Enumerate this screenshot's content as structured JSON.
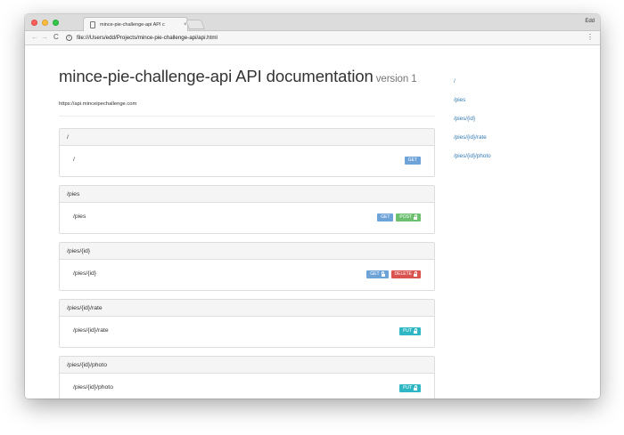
{
  "browser": {
    "tab_title": "mince-pie-challenge-api API c",
    "tab_close": "×",
    "profile_name": "Edd",
    "url": "file:///Users/edd/Projects/mince-pie-challenge-api/api.html",
    "icons": [
      "close-light",
      "minimize-light",
      "zoom-light",
      "document-icon",
      "back-arrow-icon",
      "forward-arrow-icon",
      "reload-icon",
      "info-icon",
      "menu-dots-icon",
      "lock-icon"
    ]
  },
  "page": {
    "title": "mince-pie-challenge-api API documentation",
    "version": "version 1",
    "base_url": "https://api.minceipechallenge.com"
  },
  "colors": {
    "get": "#5bc0de",
    "get_blue": "#6ea3d8",
    "post": "#5cb85c",
    "delete": "#d9534f",
    "put": "#30b7c4",
    "link": "#337ab7"
  },
  "resources": [
    {
      "header": "/",
      "path": "/",
      "methods": [
        {
          "label": "GET",
          "color": "#6ea3d8",
          "locked": false
        }
      ]
    },
    {
      "header": "/pies",
      "path": "/pies",
      "methods": [
        {
          "label": "GET",
          "color": "#6ea3d8",
          "locked": false
        },
        {
          "label": "POST",
          "color": "#6cc070",
          "locked": true
        }
      ]
    },
    {
      "header": "/pies/{id}",
      "path": "/pies/{id}",
      "methods": [
        {
          "label": "GET",
          "color": "#6ea3d8",
          "locked": true
        },
        {
          "label": "DELETE",
          "color": "#d9534f",
          "locked": true
        }
      ]
    },
    {
      "header": "/pies/{id}/rate",
      "path": "/pies/{id}/rate",
      "methods": [
        {
          "label": "PUT",
          "color": "#30b7c4",
          "locked": true
        }
      ]
    },
    {
      "header": "/pies/{id}/photo",
      "path": "/pies/{id}/photo",
      "methods": [
        {
          "label": "PUT",
          "color": "#30b7c4",
          "locked": true
        }
      ]
    }
  ],
  "sidebar": {
    "links": [
      "/",
      "/pies",
      "/pies/{id}",
      "/pies/{id}/rate",
      "/pies/{id}/photo"
    ]
  }
}
